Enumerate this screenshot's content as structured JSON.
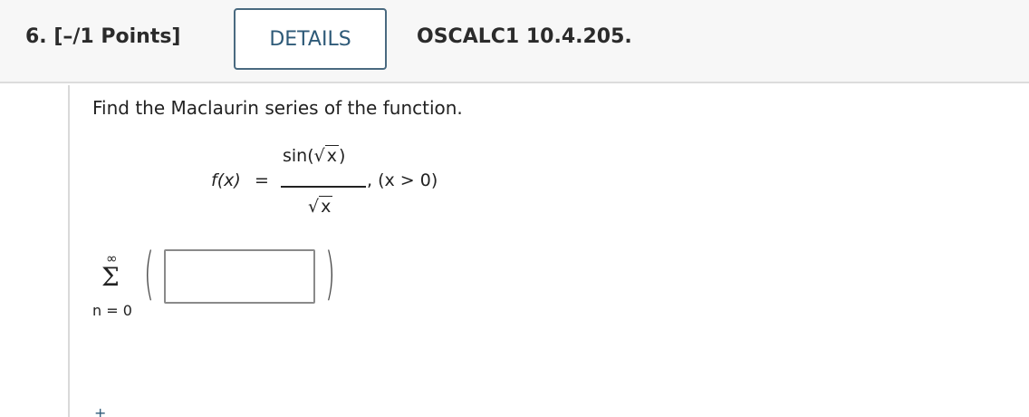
{
  "question": {
    "number_points": "6. [–/1 Points]",
    "details_label": "DETAILS",
    "source_code": "OSCALC1 10.4.205."
  },
  "problem": {
    "prompt": "Find the Maclaurin series of the function.",
    "function_lhs": "f(x)",
    "equals": "=",
    "numerator_prefix": "sin(",
    "numerator_radicand": "x",
    "numerator_suffix": ")",
    "denominator_radicand": "x",
    "condition": ", (x > 0)"
  },
  "answer": {
    "sum_upper": "∞",
    "sum_symbol": "Σ",
    "sum_lower": "n = 0",
    "open_paren": "(",
    "close_paren": ")",
    "input_value": ""
  },
  "icons": {
    "expand": "plus-icon"
  },
  "colors": {
    "accent": "#2e5a78",
    "header_bg": "#f7f7f7"
  }
}
